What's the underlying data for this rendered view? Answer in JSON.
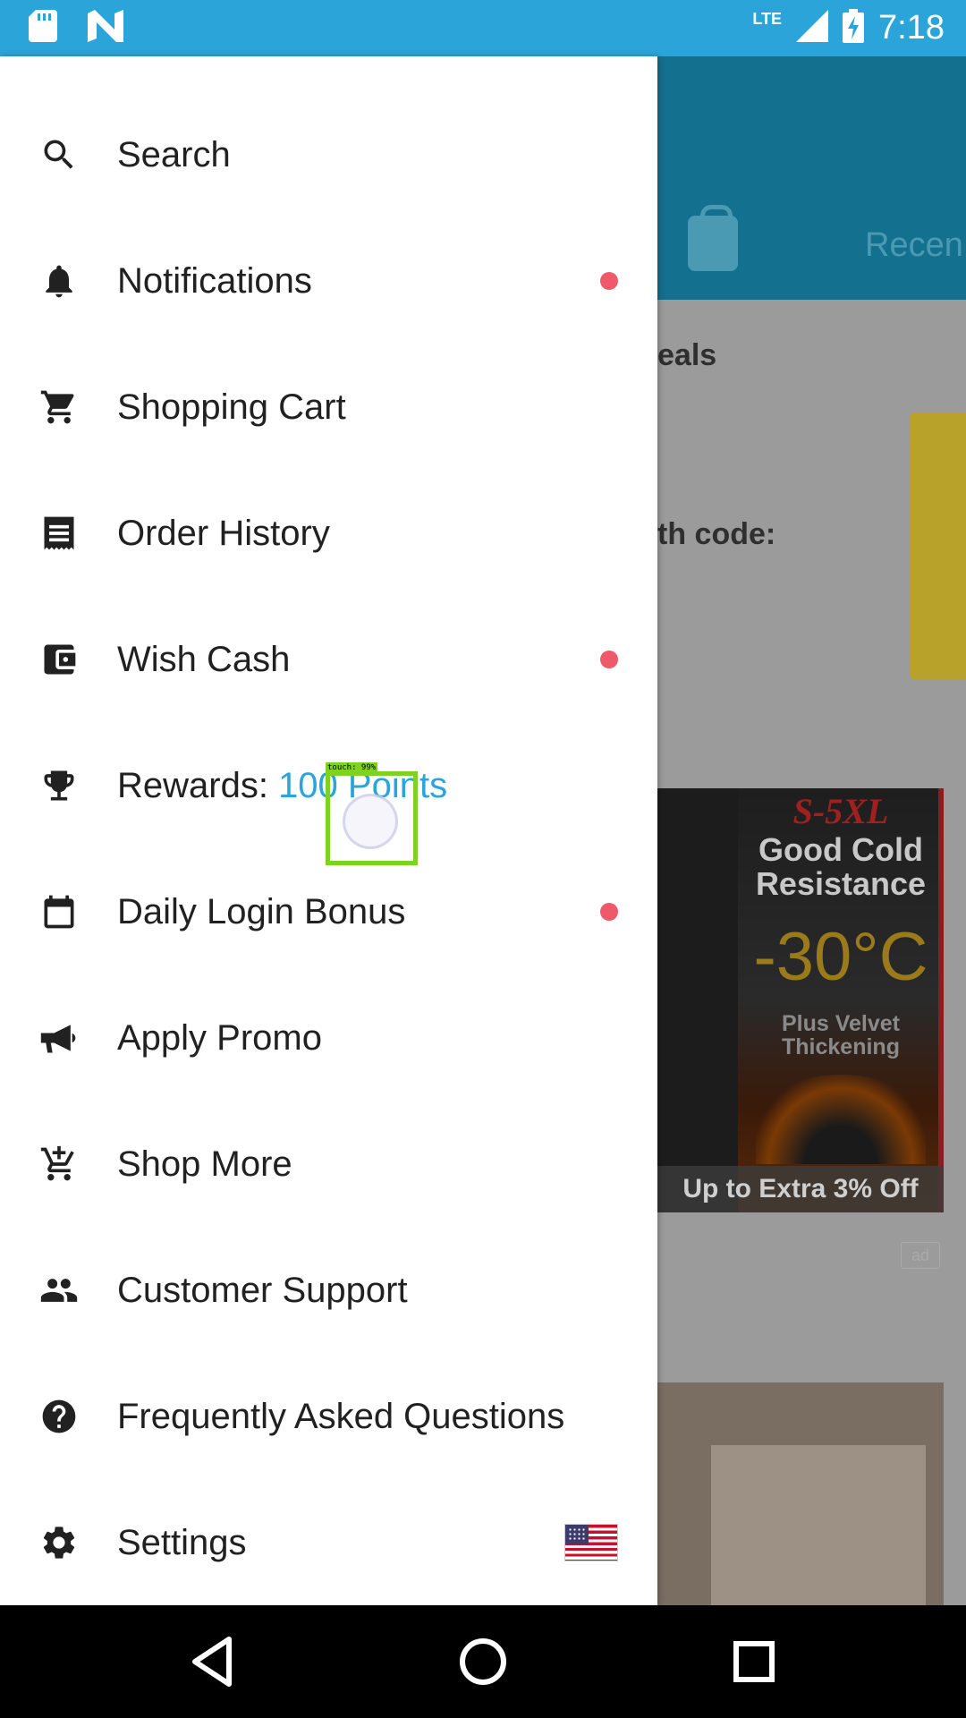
{
  "status_bar": {
    "network": "LTE",
    "time": "7:18",
    "icons": [
      "sd-card-icon",
      "n-app-icon",
      "signal-icon",
      "battery-charging-icon"
    ]
  },
  "drawer": {
    "items": [
      {
        "label": "Search",
        "icon": "search-icon",
        "dot": false
      },
      {
        "label": "Notifications",
        "icon": "bell-icon",
        "dot": true
      },
      {
        "label": "Shopping Cart",
        "icon": "cart-icon",
        "dot": false
      },
      {
        "label": "Order History",
        "icon": "receipt-icon",
        "dot": false
      },
      {
        "label": "Wish Cash",
        "icon": "wallet-icon",
        "dot": true
      },
      {
        "label": "Rewards: ",
        "points": "100 Points",
        "icon": "trophy-icon",
        "dot": false
      },
      {
        "label": "Daily Login Bonus",
        "icon": "calendar-icon",
        "dot": true
      },
      {
        "label": "Apply Promo",
        "icon": "megaphone-icon",
        "dot": false
      },
      {
        "label": "Shop More",
        "icon": "add-cart-icon",
        "dot": false
      },
      {
        "label": "Customer Support",
        "icon": "people-icon",
        "dot": false
      },
      {
        "label": "Frequently Asked Questions",
        "icon": "help-icon",
        "dot": false
      },
      {
        "label": "Settings",
        "icon": "gear-icon",
        "flag": "us-flag-icon"
      }
    ],
    "accent_color": "#2BA4D9",
    "dot_color": "#EE5A6A"
  },
  "background_app": {
    "tab_label": "Recen",
    "section_title": "eals",
    "code_text": "th code:",
    "ad": {
      "size": "S-5XL",
      "headline": "Good Cold Resistance",
      "temperature": "-30°C",
      "subline": "Plus Velvet Thickening",
      "offer": "Up to Extra 3% Off",
      "tag": "ad"
    }
  },
  "touch_indicator": {
    "label": "touch: 99%"
  },
  "nav_bar": {
    "icons": [
      "back-icon",
      "home-icon",
      "recents-icon"
    ]
  }
}
